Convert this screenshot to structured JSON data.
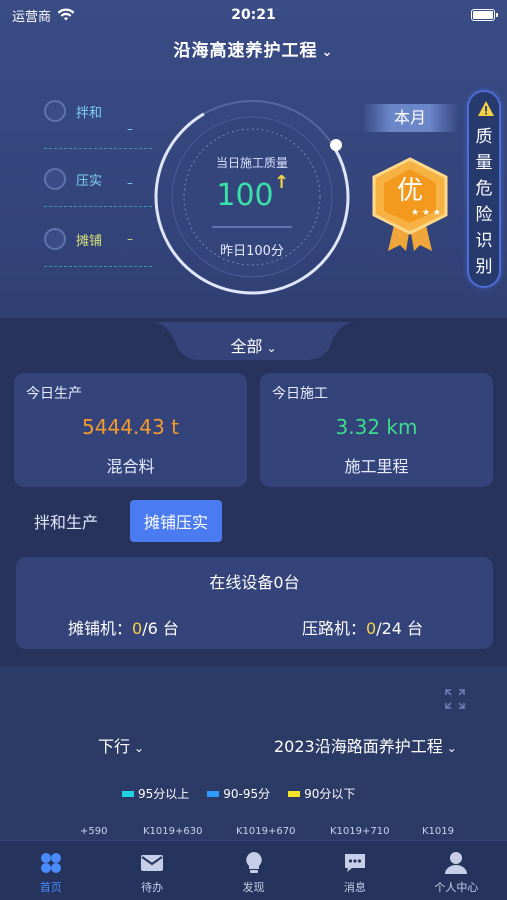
{
  "status_bar": {
    "carrier": "运营商",
    "time": "20:21"
  },
  "header": {
    "project_title": "沿海高速养护工程"
  },
  "stages": [
    {
      "label": "拌和",
      "value": "–"
    },
    {
      "label": "压实",
      "value": "–"
    },
    {
      "label": "摊铺",
      "value": "–"
    }
  ],
  "gauge": {
    "title": "当日施工质量",
    "value": "100",
    "trend": "up",
    "subtitle": "昨日100分"
  },
  "period_tag": "本月",
  "grade_badge": "优",
  "risk_button": {
    "label": "质量危险识别",
    "chars": [
      "质",
      "量",
      "危",
      "险",
      "识",
      "别"
    ]
  },
  "filter": {
    "label": "全部"
  },
  "cards": {
    "production": {
      "title": "今日生产",
      "value": "5444.43 t",
      "subtitle": "混合料"
    },
    "construction": {
      "title": "今日施工",
      "value": "3.32 km",
      "subtitle": "施工里程"
    }
  },
  "tabs": [
    {
      "label": "拌和生产",
      "active": false
    },
    {
      "label": "摊铺压实",
      "active": true
    }
  ],
  "devices": {
    "title": "在线设备0台",
    "paver": {
      "label": "摊铺机：",
      "online": "0",
      "total": "/6 台"
    },
    "roller": {
      "label": "压路机：",
      "online": "0",
      "total": "/24 台"
    }
  },
  "map": {
    "direction": "下行",
    "project": "2023沿海路面养护工程",
    "legend": [
      {
        "label": "95分以上",
        "color": "#22d3e6"
      },
      {
        "label": "90-95分",
        "color": "#2f9bff"
      },
      {
        "label": "90分以下",
        "color": "#f2e22b"
      }
    ],
    "ticks": [
      "+590",
      "K1019+630",
      "K1019+670",
      "K1019+710",
      "K1019"
    ]
  },
  "colors": {
    "accent": "#4a7bf0",
    "orange_value": "#f29a2e",
    "green_value": "#3ddc8c",
    "gauge_value": "#39e0a7",
    "highlight": "#f5d343"
  },
  "tabbar": [
    {
      "label": "首页",
      "icon": "home-grid-icon",
      "active": true
    },
    {
      "label": "待办",
      "icon": "mail-icon",
      "active": false
    },
    {
      "label": "发现",
      "icon": "bulb-icon",
      "active": false
    },
    {
      "label": "消息",
      "icon": "chat-icon",
      "active": false
    },
    {
      "label": "个人中心",
      "icon": "user-icon",
      "active": false
    }
  ]
}
